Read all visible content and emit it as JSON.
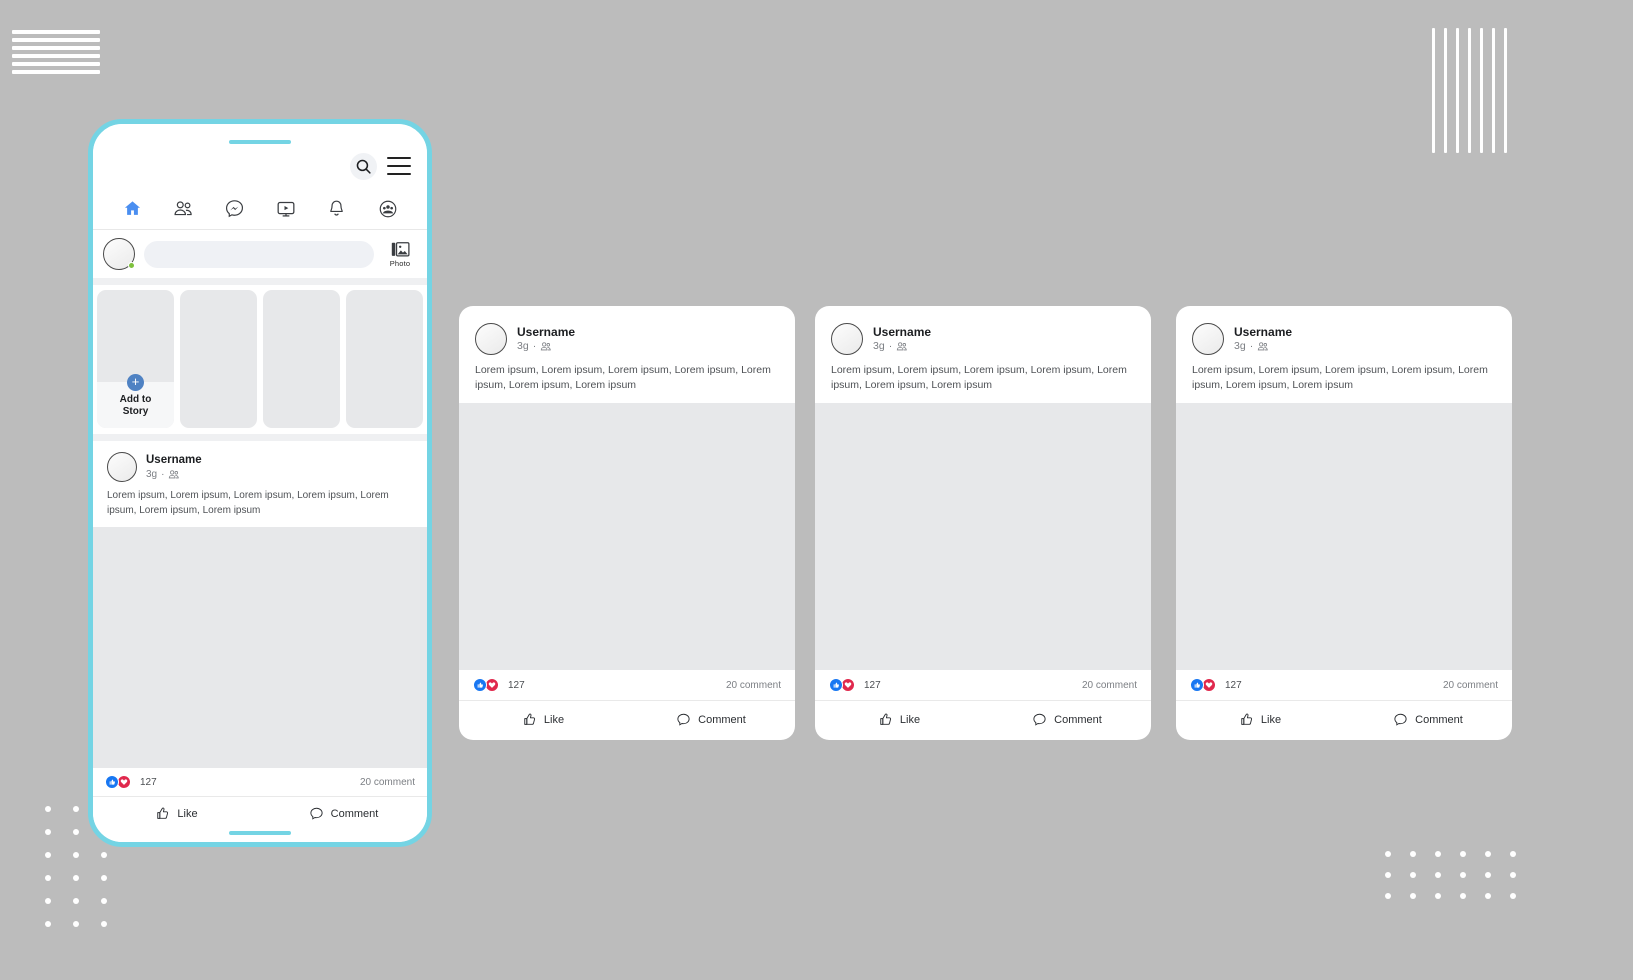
{
  "theme": {
    "background": "#bcbcbc",
    "phone_frame": "#74d4e4",
    "accent_blue": "#1877f2",
    "nav_active": "#4a8ef0",
    "like_badge": "#1877f2",
    "love_badge": "#e0294d",
    "placeholder_gray": "#e7e8ea",
    "card_white": "#ffffff"
  },
  "phone": {
    "topbar": {
      "search_icon": "search-icon",
      "menu_icon": "hamburger-menu-icon"
    },
    "nav_items": [
      {
        "name": "home",
        "icon": "home-icon",
        "active": true
      },
      {
        "name": "friends",
        "icon": "friends-icon",
        "active": false
      },
      {
        "name": "messenger",
        "icon": "messenger-icon",
        "active": false
      },
      {
        "name": "watch",
        "icon": "video-play-icon",
        "active": false
      },
      {
        "name": "notifications",
        "icon": "bell-icon",
        "active": false
      },
      {
        "name": "groups",
        "icon": "groups-icon",
        "active": false
      }
    ],
    "composer": {
      "placeholder": "",
      "photo_label": "Photo",
      "photo_icon": "image-icon",
      "avatar_icon": "avatar",
      "online_status": "online"
    },
    "stories": {
      "add_plus_icon": "plus-circle-icon",
      "add_label_line1": "Add to",
      "add_label_line2": "Story",
      "count": 4
    },
    "post": {
      "username": "Username",
      "time": "3g",
      "separator": "·",
      "audience_icon": "friends-audience-icon",
      "body": "Lorem ipsum, Lorem ipsum, Lorem ipsum, Lorem ipsum, Lorem ipsum, Lorem ipsum, Lorem ipsum",
      "reaction_count": "127",
      "comment_count": "20 comment",
      "like_label": "Like",
      "comment_label": "Comment",
      "like_icon": "thumbs-up-icon",
      "comment_icon": "speech-bubble-icon",
      "reaction_badges": [
        "thumbs-up-badge",
        "heart-badge"
      ]
    }
  },
  "cards": [
    {
      "username": "Username",
      "time": "3g",
      "separator": "·",
      "body": "Lorem ipsum, Lorem ipsum, Lorem ipsum, Lorem ipsum, Lorem ipsum, Lorem ipsum, Lorem ipsum",
      "reaction_count": "127",
      "comment_count": "20 comment",
      "like_label": "Like",
      "comment_label": "Comment"
    },
    {
      "username": "Username",
      "time": "3g",
      "separator": "·",
      "body": "Lorem ipsum, Lorem ipsum, Lorem ipsum, Lorem ipsum, Lorem ipsum, Lorem ipsum, Lorem ipsum",
      "reaction_count": "127",
      "comment_count": "20 comment",
      "like_label": "Like",
      "comment_label": "Comment"
    },
    {
      "username": "Username",
      "time": "3g",
      "separator": "·",
      "body": "Lorem ipsum, Lorem ipsum, Lorem ipsum, Lorem ipsum, Lorem ipsum, Lorem ipsum, Lorem ipsum",
      "reaction_count": "127",
      "comment_count": "20 comment",
      "like_label": "Like",
      "comment_label": "Comment"
    }
  ],
  "decorations": {
    "horizontal_lines_count": 6,
    "vertical_lines_count": 7,
    "dot_grid_left": "dot-grid",
    "dot_grid_right": "dot-grid"
  }
}
